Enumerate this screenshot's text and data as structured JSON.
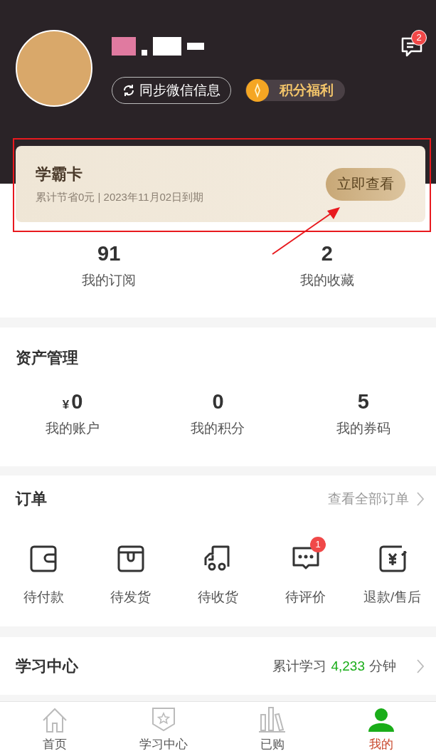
{
  "header": {
    "sync_button": "同步微信信息",
    "points_button": "积分福利",
    "messages_badge": "2"
  },
  "vip_card": {
    "title": "学霸卡",
    "subtitle": "累计节省0元 | 2023年11月02日到期",
    "button": "立即查看"
  },
  "stats": [
    {
      "value": "91",
      "label": "我的订阅"
    },
    {
      "value": "2",
      "label": "我的收藏"
    }
  ],
  "assets": {
    "title": "资产管理",
    "items": [
      {
        "prefix": "¥",
        "value": "0",
        "label": "我的账户"
      },
      {
        "value": "0",
        "label": "我的积分"
      },
      {
        "value": "5",
        "label": "我的券码"
      }
    ]
  },
  "orders": {
    "title": "订单",
    "link": "查看全部订单",
    "items": [
      {
        "kind": "wallet",
        "label": "待付款"
      },
      {
        "kind": "box",
        "label": "待发货"
      },
      {
        "kind": "truck",
        "label": "待收货"
      },
      {
        "kind": "comment",
        "label": "待评价",
        "badge": "1"
      },
      {
        "kind": "refund",
        "label": "退款/售后"
      }
    ]
  },
  "study": {
    "title": "学习中心",
    "summary_prefix": "累计学习",
    "minutes": "4,233",
    "unit": "分钟"
  },
  "tabbar": [
    {
      "kind": "home",
      "label": "首页",
      "selected": false
    },
    {
      "kind": "badge",
      "label": "学习中心",
      "selected": false
    },
    {
      "kind": "books",
      "label": "已购",
      "selected": false
    },
    {
      "kind": "user",
      "label": "我的",
      "selected": true
    }
  ]
}
